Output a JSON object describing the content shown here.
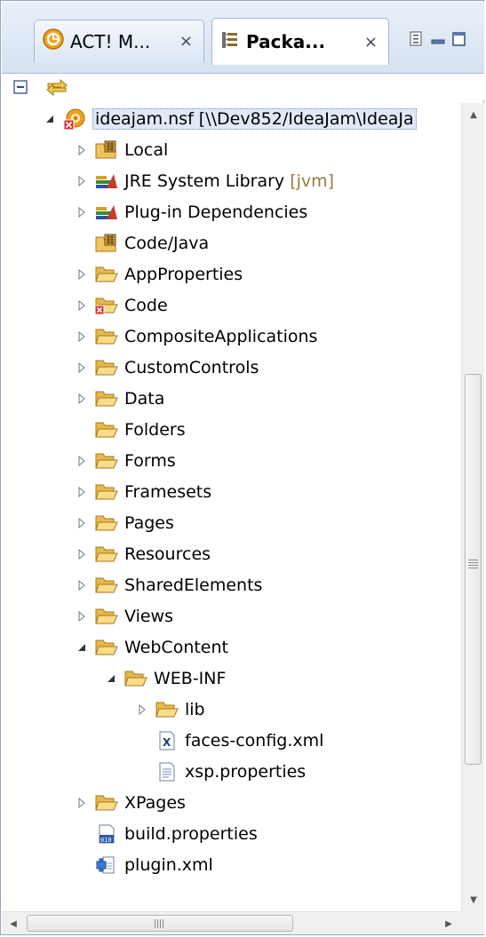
{
  "tabs": [
    {
      "label": "ACT! M...",
      "close": "×",
      "icon": "domino-designer-icon"
    },
    {
      "label": "Packa...",
      "close": "×",
      "icon": "package-explorer-icon"
    }
  ],
  "toolbar": {
    "collapse_all": "collapse-all-icon",
    "link_with_editor": "link-with-editor-icon"
  },
  "tree": {
    "root": {
      "label": "ideajam.nsf [\\\\Dev852/IdeaJam\\IdeaJa",
      "icon": "nsf-project-error-icon"
    },
    "items": [
      {
        "label": "Local",
        "icon": "source-folder-icon",
        "expanded": false
      },
      {
        "label": "JRE System Library",
        "decoration": "[jvm]",
        "icon": "library-icon",
        "expanded": false
      },
      {
        "label": "Plug-in Dependencies",
        "icon": "library-icon",
        "expanded": false
      },
      {
        "label": "Code/Java",
        "icon": "source-folder-icon",
        "expanded": null
      },
      {
        "label": "AppProperties",
        "icon": "folder-icon",
        "expanded": false
      },
      {
        "label": "Code",
        "icon": "folder-error-icon",
        "expanded": false
      },
      {
        "label": "CompositeApplications",
        "icon": "folder-icon",
        "expanded": false
      },
      {
        "label": "CustomControls",
        "icon": "folder-icon",
        "expanded": false
      },
      {
        "label": "Data",
        "icon": "folder-icon",
        "expanded": false
      },
      {
        "label": "Folders",
        "icon": "folder-icon",
        "expanded": null
      },
      {
        "label": "Forms",
        "icon": "folder-icon",
        "expanded": false
      },
      {
        "label": "Framesets",
        "icon": "folder-icon",
        "expanded": false
      },
      {
        "label": "Pages",
        "icon": "folder-icon",
        "expanded": false
      },
      {
        "label": "Resources",
        "icon": "folder-icon",
        "expanded": false
      },
      {
        "label": "SharedElements",
        "icon": "folder-icon",
        "expanded": false
      },
      {
        "label": "Views",
        "icon": "folder-icon",
        "expanded": false
      },
      {
        "label": "WebContent",
        "icon": "folder-icon",
        "expanded": true
      },
      {
        "label": "WEB-INF",
        "icon": "folder-icon",
        "expanded": true
      },
      {
        "label": "lib",
        "icon": "folder-icon",
        "expanded": false
      },
      {
        "label": "faces-config.xml",
        "icon": "xml-file-icon",
        "expanded": null
      },
      {
        "label": "xsp.properties",
        "icon": "text-file-icon",
        "expanded": null
      },
      {
        "label": "XPages",
        "icon": "folder-icon",
        "expanded": false
      },
      {
        "label": "build.properties",
        "icon": "binary-properties-file-icon",
        "expanded": null
      },
      {
        "label": "plugin.xml",
        "icon": "plugin-manifest-icon",
        "expanded": null
      }
    ]
  },
  "scrollbars": {
    "v_grip": "≡",
    "h_grip": "III"
  },
  "colors": {
    "tab_bg": "#dde7f4",
    "folder": "#e8b84a",
    "error": "#d93030",
    "selection": "#dfe9f8"
  }
}
